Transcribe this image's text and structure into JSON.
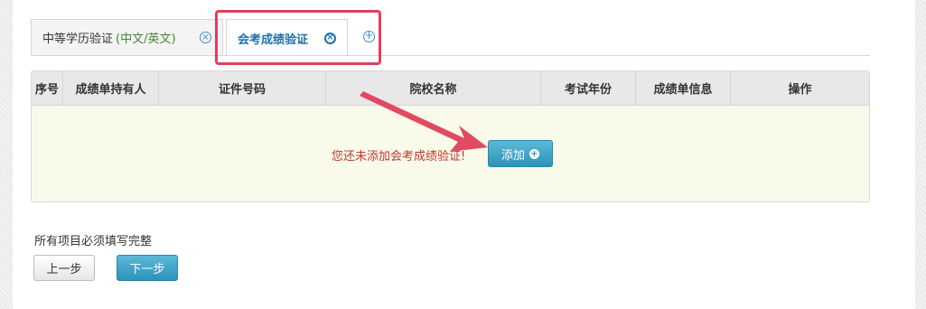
{
  "tabs": [
    {
      "label": "中等学历验证",
      "sub": "(中文/英文)",
      "close_icon": "×"
    },
    {
      "label": "会考成绩验证",
      "close_icon": "×"
    }
  ],
  "add_tab_icon": "+",
  "table": {
    "headers": [
      "序号",
      "成绩单持有人",
      "证件号码",
      "院校名称",
      "考试年份",
      "成绩单信息",
      "操作"
    ],
    "empty_message": "您还未添加会考成绩验证!",
    "add_button": "添加",
    "add_icon": "+"
  },
  "form": {
    "notice": "所有项目必须填写完整",
    "prev_button": "上一步",
    "next_button": "下一步"
  },
  "colors": {
    "highlight": "#e0405a",
    "accent": "#2c93b9",
    "active_tab_text": "#1f6fb2",
    "empty_message": "#c0392b"
  }
}
